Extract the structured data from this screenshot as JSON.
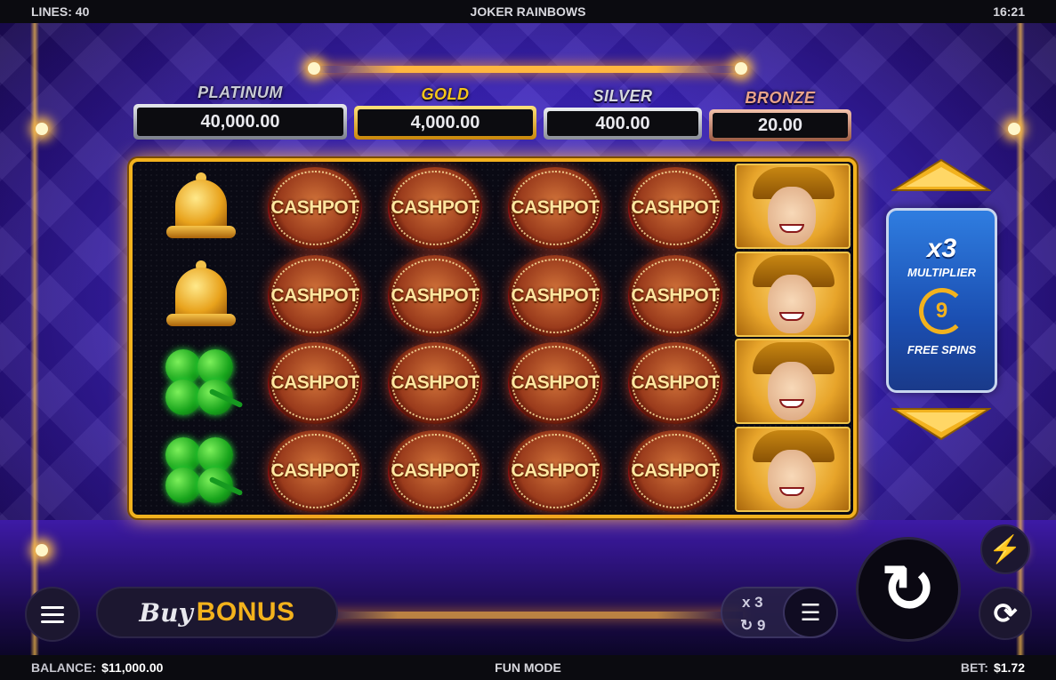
{
  "header": {
    "lines": "LINES: 40",
    "title": "JOKER RAINBOWS",
    "clock": "16:21"
  },
  "footer": {
    "balance_label": "BALANCE:",
    "balance_value": "$11,000.00",
    "mode": "FUN MODE",
    "bet_label": "BET:",
    "bet_value": "$1.72"
  },
  "jackpots": [
    {
      "label": "PLATINUM",
      "value": "40,000.00",
      "color": "#c9ccd4"
    },
    {
      "label": "GOLD",
      "value": "4,000.00",
      "color": "#f5c518"
    },
    {
      "label": "SILVER",
      "value": "400.00",
      "color": "#d6d8de"
    },
    {
      "label": "BRONZE",
      "value": "20.00",
      "color": "#e9a38a"
    }
  ],
  "reels": {
    "cashpot_text": "CASHPOT",
    "columns": [
      [
        "bell",
        "bell",
        "clover",
        "clover"
      ],
      [
        "cashpot",
        "cashpot",
        "cashpot",
        "cashpot"
      ],
      [
        "cashpot",
        "cashpot",
        "cashpot",
        "cashpot"
      ],
      [
        "cashpot",
        "cashpot",
        "cashpot",
        "cashpot"
      ],
      [
        "cashpot",
        "cashpot",
        "cashpot",
        "cashpot"
      ],
      [
        "joker",
        "joker",
        "joker",
        "joker"
      ]
    ]
  },
  "feature_panel": {
    "multiplier": "x3",
    "multiplier_label": "MULTIPLIER",
    "spins": "9",
    "spins_label": "FREE SPINS"
  },
  "controls": {
    "buy_label": "Buy",
    "bonus_label": "BONUS",
    "feature_mult": "x 3",
    "feature_spins": "9",
    "menu_icon": "hamburger-menu-icon",
    "spin_icon": "spin-arrow-icon",
    "turbo_icon": "lightning-icon",
    "auto_icon": "autoplay-icon",
    "coins_icon": "coin-stack-icon"
  },
  "colors": {
    "reel_frame": "#f2b21e",
    "accent_gold": "#f3b21c",
    "turbo_green": "#5fd63a",
    "panel_blue": "#1b4fb2"
  }
}
